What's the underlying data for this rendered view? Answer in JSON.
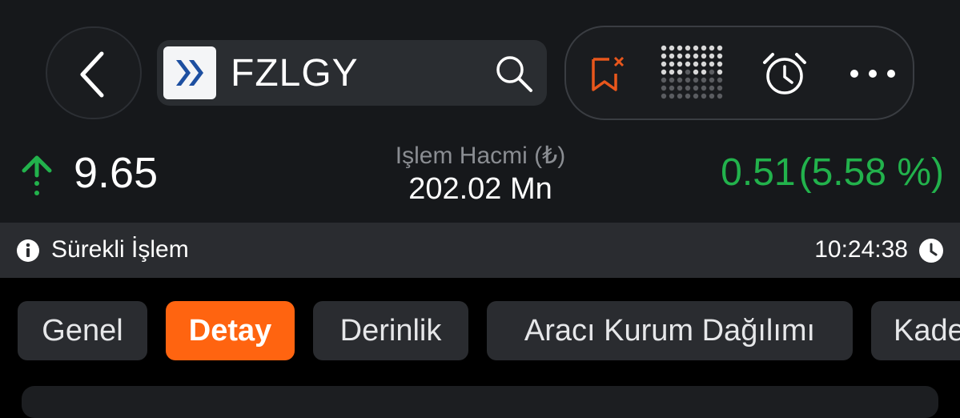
{
  "header": {
    "ticker": "FZLGY",
    "colors": {
      "accent": "#ff6410",
      "positive": "#22b24c",
      "alert_icon": "#e8561c"
    },
    "icons": [
      "back-chevron-icon",
      "brand-logo-icon",
      "search-icon",
      "bookmark-remove-icon",
      "dot-matrix-icon",
      "alarm-clock-icon",
      "more-dots-icon"
    ]
  },
  "quote": {
    "price": "9.65",
    "volume_label": "Işlem Hacmi (₺)",
    "volume_value": "202.02 Mn",
    "change": "0.51",
    "change_pct": "(5.58 %)"
  },
  "status": {
    "label": "Sürekli İşlem",
    "time": "10:24:38"
  },
  "tabs": [
    {
      "label": "Genel",
      "active": false
    },
    {
      "label": "Detay",
      "active": true
    },
    {
      "label": "Derinlik",
      "active": false
    },
    {
      "label": "Aracı Kurum Dağılımı",
      "active": false
    },
    {
      "label": "Kademe",
      "active": false
    }
  ]
}
